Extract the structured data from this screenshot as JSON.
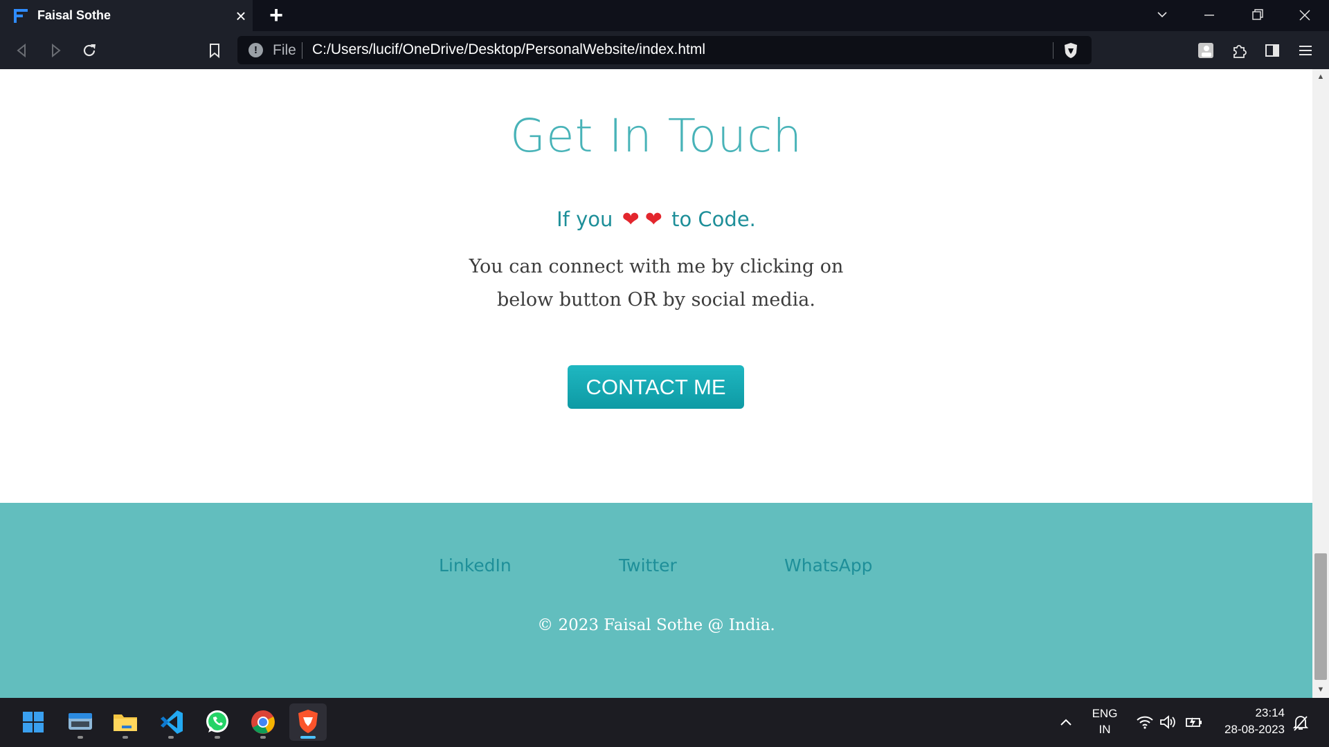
{
  "browser": {
    "tab_title": "Faisal Sothe",
    "url_scheme": "File",
    "url": "C:/Users/lucif/OneDrive/Desktop/PersonalWebsite/index.html",
    "tab_close_icon": "close-icon",
    "new_tab_icon": "plus-icon"
  },
  "page": {
    "heading": "Get In Touch",
    "subhead_before": "If you",
    "subhead_after": "to Code.",
    "hearts": [
      "❤",
      "❤"
    ],
    "body": "You can connect with me by clicking on below button OR by social media.",
    "contact_button": "CONTACT ME",
    "footer": {
      "links": [
        "LinkedIn",
        "Twitter",
        "WhatsApp"
      ],
      "copyright": "© 2023 Faisal Sothe @ India."
    }
  },
  "taskbar": {
    "lang": "ENG",
    "region": "IN",
    "time": "23:14",
    "date": "28-08-2023"
  },
  "colors": {
    "accent": "#48b3b8",
    "button": "#13a7b1",
    "footer": "#62bebe"
  }
}
